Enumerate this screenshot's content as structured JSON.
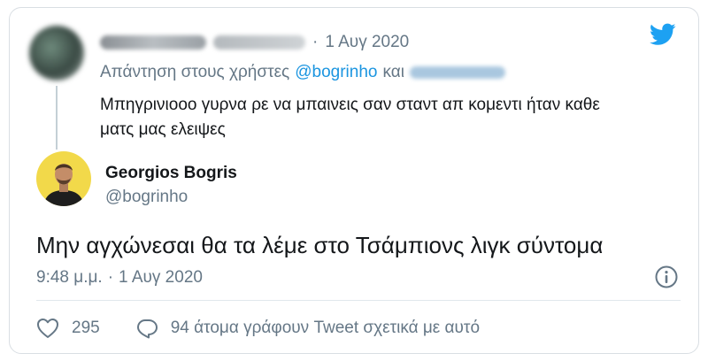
{
  "parent": {
    "date_sep": "·",
    "date": "1 Αυγ 2020",
    "reply_prefix": "Απάντηση στους χρήστες",
    "reply_handle": "@bogrinho",
    "reply_conj": "και",
    "text": "Μπηγρινιοοο γυρνα ρε να μπαινεις σαν σταντ απ κομεντι ήταν καθε ματς μας ελειψες"
  },
  "author": {
    "name": "Georgios Bogris",
    "handle": "@bogrinho"
  },
  "tweet": {
    "text": "Μην αγχώνεσαι θα τα λέμε στο Τσάμπιονς λιγκ σύντομα",
    "time": "9:48 μ.μ.",
    "sep": "·",
    "date": "1 Αυγ 2020"
  },
  "actions": {
    "likes": "295",
    "discussion": "94 άτομα γράφουν Tweet σχετικά με αυτό"
  },
  "colors": {
    "accent": "#1da1f2",
    "muted": "#657786",
    "avatar_bg": "#f2d94a"
  },
  "icons": [
    "twitter-bird-icon",
    "info-icon",
    "heart-icon",
    "comment-bubble-icon"
  ]
}
